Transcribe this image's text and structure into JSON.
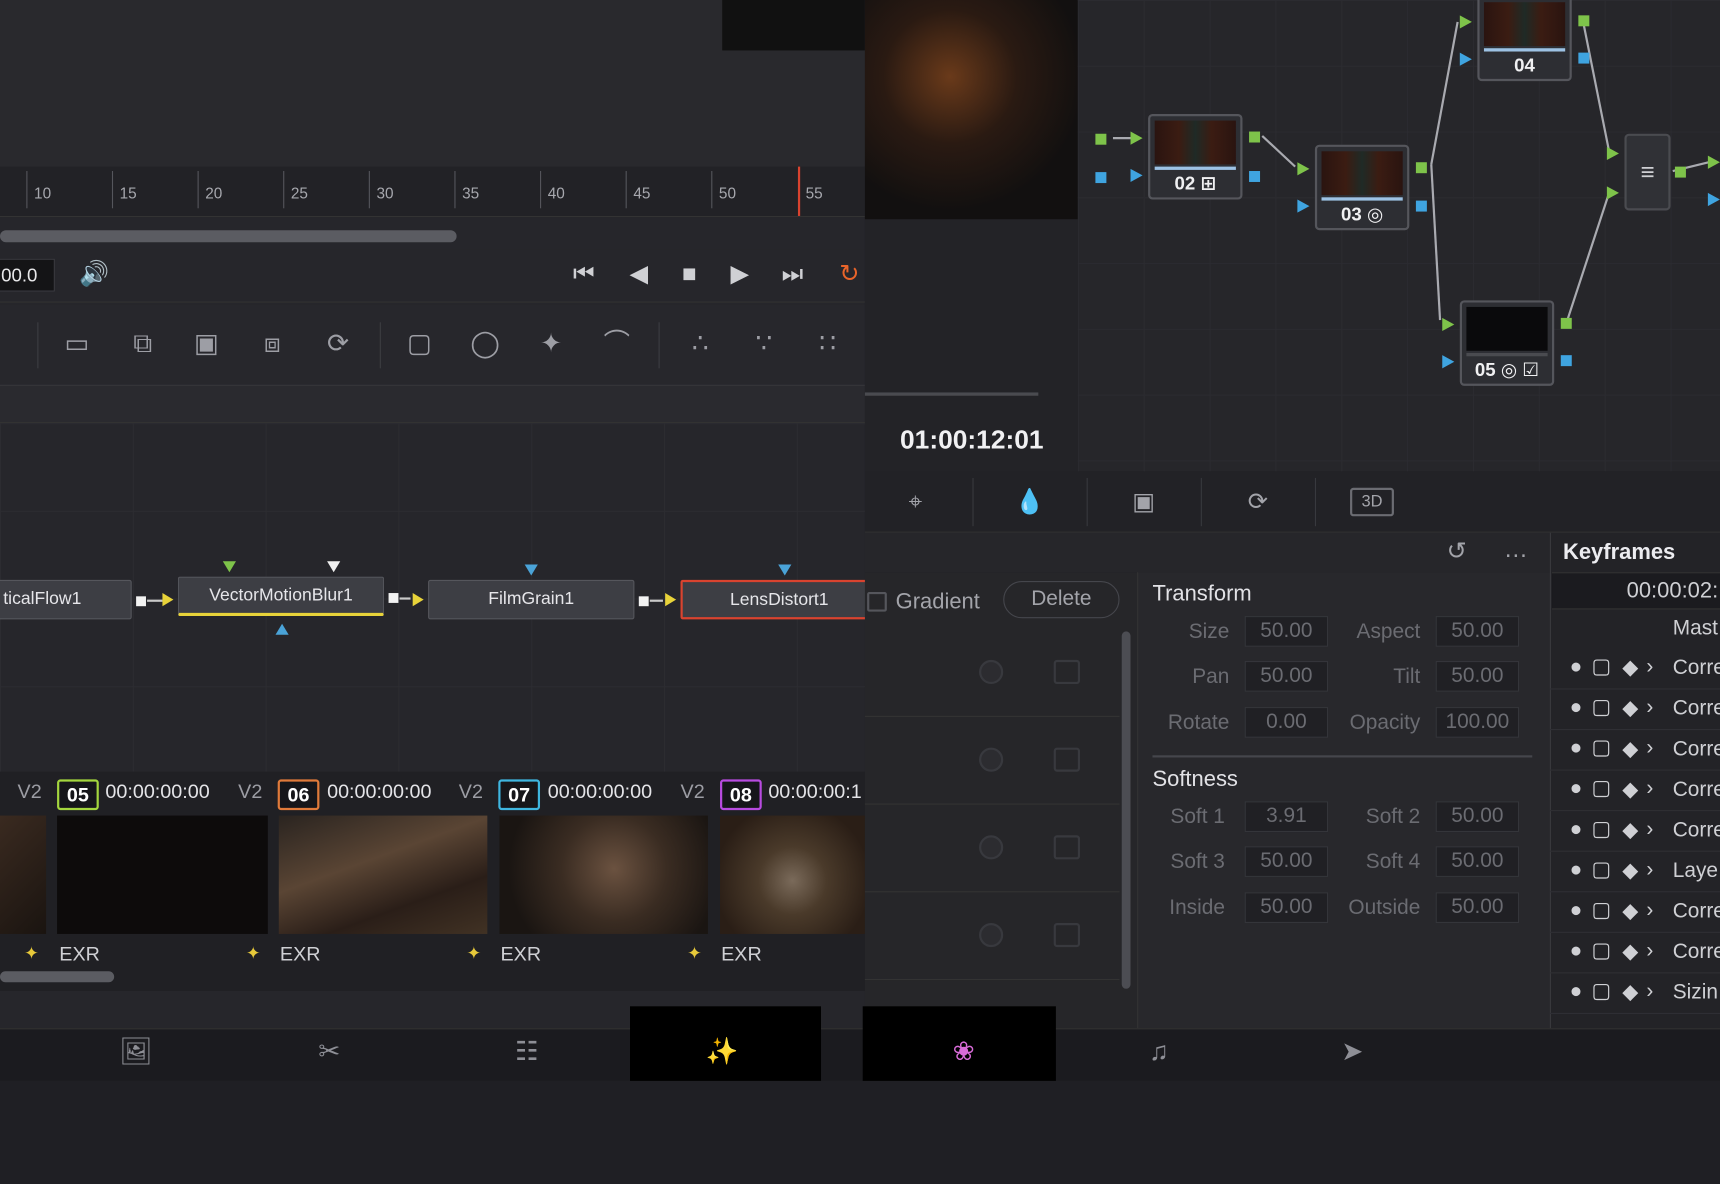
{
  "ruler": {
    "ticks": [
      "10",
      "15",
      "20",
      "25",
      "30",
      "35",
      "40",
      "45",
      "50",
      "55"
    ]
  },
  "transport": {
    "timecode": "00.0"
  },
  "flow": {
    "nodes": [
      "ticalFlow1",
      "VectorMotionBlur1",
      "FilmGrain1",
      "LensDistort1"
    ]
  },
  "clips": [
    {
      "track": "V2",
      "num": "05",
      "tc": "00:00:00:00",
      "fmt": "EXR",
      "color": "#a4d63e"
    },
    {
      "track": "V2",
      "num": "06",
      "tc": "00:00:00:00",
      "fmt": "EXR",
      "color": "#e07a3a"
    },
    {
      "track": "V2",
      "num": "07",
      "tc": "00:00:00:00",
      "fmt": "EXR",
      "color": "#3fb6e0"
    },
    {
      "track": "V2",
      "num": "08",
      "tc": "00:00:00:1",
      "fmt": "EXR",
      "color": "#b84be0"
    }
  ],
  "viewer": {
    "timecode": "01:00:12:01"
  },
  "colornodes": [
    "02",
    "03",
    "04",
    "05"
  ],
  "mask": {
    "gradient_label": "Gradient",
    "delete_label": "Delete"
  },
  "transform": {
    "title": "Transform",
    "params": [
      {
        "l1": "Size",
        "v1": "50.00",
        "l2": "Aspect",
        "v2": "50.00"
      },
      {
        "l1": "Pan",
        "v1": "50.00",
        "l2": "Tilt",
        "v2": "50.00"
      },
      {
        "l1": "Rotate",
        "v1": "0.00",
        "l2": "Opacity",
        "v2": "100.00"
      }
    ]
  },
  "softness": {
    "title": "Softness",
    "params": [
      {
        "l1": "Soft 1",
        "v1": "3.91",
        "l2": "Soft 2",
        "v2": "50.00"
      },
      {
        "l1": "Soft 3",
        "v1": "50.00",
        "l2": "Soft 4",
        "v2": "50.00"
      },
      {
        "l1": "Inside",
        "v1": "50.00",
        "l2": "Outside",
        "v2": "50.00"
      }
    ]
  },
  "keyframes": {
    "title": "Keyframes",
    "time": "00:00:02:",
    "master": "Mast",
    "rows": [
      "Corre",
      "Corre",
      "Corre",
      "Corre",
      "Corre",
      "Laye",
      "Corre",
      "Corre",
      "Sizin"
    ]
  },
  "tools": {
    "threed": "3D"
  }
}
